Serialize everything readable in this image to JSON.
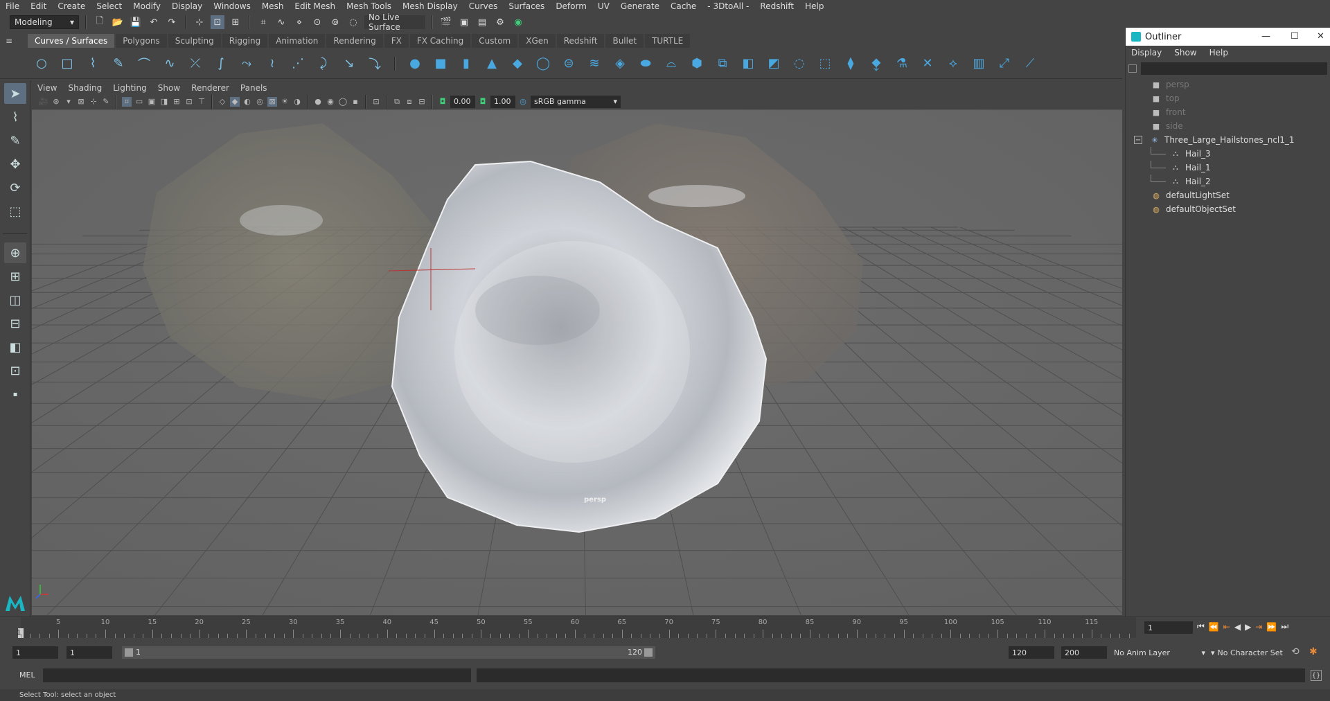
{
  "menubar": [
    "File",
    "Edit",
    "Create",
    "Select",
    "Modify",
    "Display",
    "Windows",
    "Mesh",
    "Edit Mesh",
    "Mesh Tools",
    "Mesh Display",
    "Curves",
    "Surfaces",
    "Deform",
    "UV",
    "Generate",
    "Cache",
    "- 3DtoAll -",
    "Redshift",
    "Help"
  ],
  "status": {
    "workspace": "Modeling",
    "live_surface": "No Live Surface"
  },
  "shelf_tabs": [
    "Curves / Surfaces",
    "Polygons",
    "Sculpting",
    "Rigging",
    "Animation",
    "Rendering",
    "FX",
    "FX Caching",
    "Custom",
    "XGen",
    "Redshift",
    "Bullet",
    "TURTLE"
  ],
  "shelf_active": "Curves / Surfaces",
  "panel_menu": [
    "View",
    "Shading",
    "Lighting",
    "Show",
    "Renderer",
    "Panels"
  ],
  "panel_fields": {
    "exposure": "0.00",
    "gamma": "1.00",
    "color_space": "sRGB gamma"
  },
  "viewport": {
    "camera_label": "persp"
  },
  "outliner": {
    "title": "Outliner",
    "menu": [
      "Display",
      "Show",
      "Help"
    ],
    "items": [
      {
        "label": "persp",
        "icon": "camera-icon",
        "indent": 0,
        "dim": true
      },
      {
        "label": "top",
        "icon": "camera-icon",
        "indent": 0,
        "dim": true
      },
      {
        "label": "front",
        "icon": "camera-icon",
        "indent": 0,
        "dim": true
      },
      {
        "label": "side",
        "icon": "camera-icon",
        "indent": 0,
        "dim": true
      },
      {
        "label": "Three_Large_Hailstones_ncl1_1",
        "icon": "group-icon",
        "indent": 0,
        "dim": false,
        "expanded": true
      },
      {
        "label": "Hail_3",
        "icon": "mesh-icon",
        "indent": 1,
        "dim": false
      },
      {
        "label": "Hail_1",
        "icon": "mesh-icon",
        "indent": 1,
        "dim": false
      },
      {
        "label": "Hail_2",
        "icon": "mesh-icon",
        "indent": 1,
        "dim": false
      },
      {
        "label": "defaultLightSet",
        "icon": "set-icon",
        "indent": 0,
        "dim": false
      },
      {
        "label": "defaultObjectSet",
        "icon": "set-icon",
        "indent": 0,
        "dim": false
      }
    ]
  },
  "timeline": {
    "ticks": [
      5,
      10,
      15,
      20,
      25,
      30,
      35,
      40,
      45,
      50,
      55,
      60,
      65,
      70,
      75,
      80,
      85,
      90,
      95,
      100,
      105,
      110,
      115
    ],
    "start_label": "1",
    "current_frame": "1"
  },
  "range": {
    "start": "1",
    "start2": "1",
    "slider_start": "1",
    "slider_end": "120",
    "end": "120",
    "end2": "200",
    "anim_layer": "No Anim Layer",
    "char_set": "No Character Set"
  },
  "cmdline": {
    "lang": "MEL"
  },
  "helpline": "Select Tool: select an object",
  "colors": {
    "accent": "#5d6f80",
    "maya_logo": "#19b6c4"
  }
}
